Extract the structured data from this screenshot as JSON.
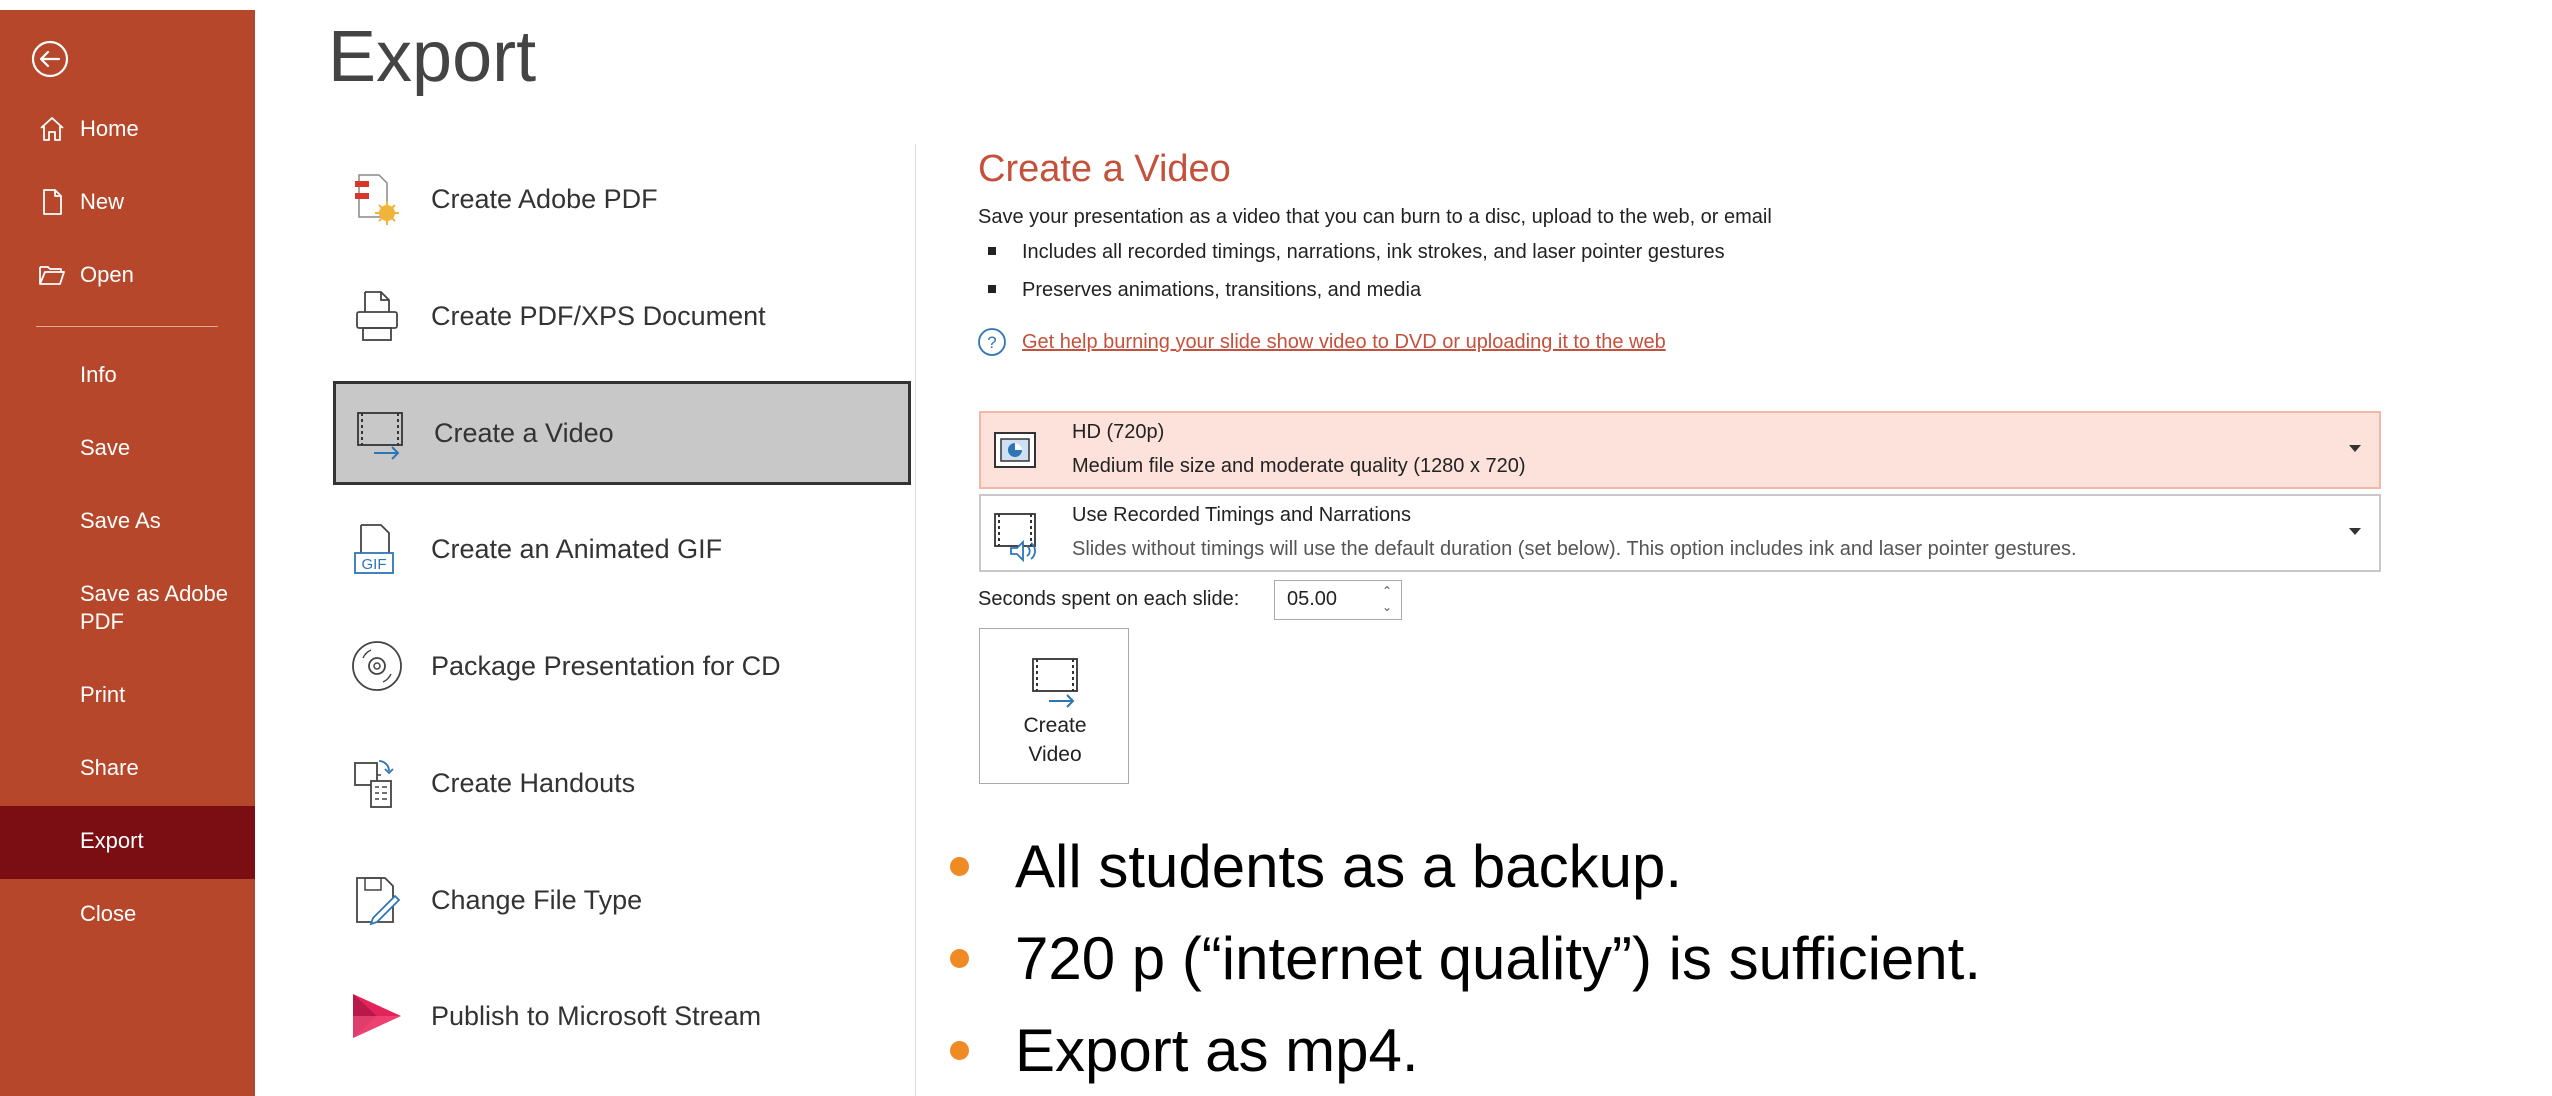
{
  "sidebar": {
    "items": [
      {
        "label": "Home"
      },
      {
        "label": "New"
      },
      {
        "label": "Open"
      },
      {
        "label": "Info"
      },
      {
        "label": "Save"
      },
      {
        "label": "Save As"
      },
      {
        "label": "Save as Adobe PDF"
      },
      {
        "label": "Print"
      },
      {
        "label": "Share"
      },
      {
        "label": "Export"
      },
      {
        "label": "Close"
      }
    ],
    "active": "Export",
    "colors": {
      "background": "#B7472A",
      "active": "#7B0E12"
    }
  },
  "page": {
    "title": "Export"
  },
  "export_options": [
    {
      "label": "Create Adobe PDF",
      "icon": "adobe-pdf-icon"
    },
    {
      "label": "Create PDF/XPS Document",
      "icon": "pdf-xps-icon"
    },
    {
      "label": "Create a Video",
      "icon": "video-icon",
      "selected": true
    },
    {
      "label": "Create an Animated GIF",
      "icon": "gif-icon"
    },
    {
      "label": "Package Presentation for CD",
      "icon": "cd-icon"
    },
    {
      "label": "Create Handouts",
      "icon": "handouts-icon"
    },
    {
      "label": "Change File Type",
      "icon": "change-file-type-icon"
    },
    {
      "label": "Publish to Microsoft Stream",
      "icon": "stream-icon"
    }
  ],
  "panel": {
    "title": "Create a Video",
    "description": "Save your presentation as a video that you can burn to a disc, upload to the web, or email",
    "bullets": [
      "Includes all recorded timings, narrations, ink strokes, and laser pointer gestures",
      "Preserves animations, transitions, and media"
    ],
    "help_link": "Get help burning your slide show video to DVD or uploading it to the web",
    "quality": {
      "title": "HD (720p)",
      "subtitle": "Medium file size and moderate quality (1280 x 720)"
    },
    "timings": {
      "title": "Use Recorded Timings and Narrations",
      "subtitle": "Slides without timings will use the default duration (set below). This option includes ink and laser pointer gestures."
    },
    "seconds_label": "Seconds spent on each slide:",
    "seconds_value": "05.00",
    "create_button_line1": "Create",
    "create_button_line2": "Video",
    "accent_color": "#C4513B"
  },
  "slide_bullets": [
    "All students as a backup.",
    "720 p (“internet quality”) is sufficient.",
    "Export as mp4."
  ]
}
